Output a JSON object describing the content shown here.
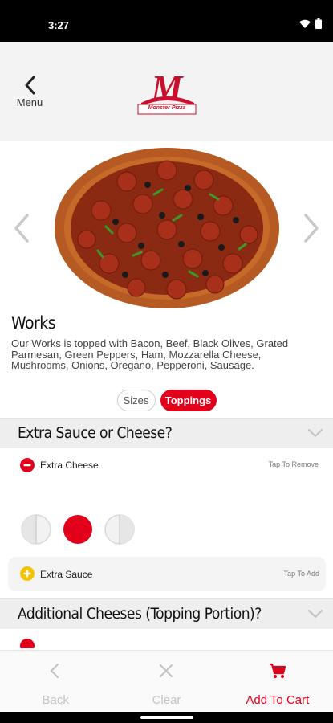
{
  "status_bar": {
    "time": "3:27"
  },
  "header": {
    "back_label": "Menu",
    "logo_letter": "M",
    "logo_text": "Monster Pizza"
  },
  "item": {
    "title": "Works",
    "description": "Our Works is topped with Bacon, Beef, Black Olives, Grated Parmesan, Green Peppers, Ham, Mozzarella Cheese, Mushrooms, Onions, Oregano, Pepperoni, Sausage."
  },
  "tabs": [
    {
      "label": "Sizes",
      "selected": false
    },
    {
      "label": "Toppings",
      "selected": true
    }
  ],
  "sections": [
    {
      "title": "Extra Sauce or Cheese?",
      "options": [
        {
          "label": "Extra Cheese",
          "hint": "Tap To Remove",
          "state": "selected",
          "icon": "minus-circle-icon"
        },
        {
          "label": "Extra Sauce",
          "hint": "Tap To Add",
          "state": "unselected",
          "icon": "plus-circle-icon"
        }
      ],
      "portion_selected": "whole"
    },
    {
      "title": "Additional Cheeses (Topping Portion)?"
    }
  ],
  "bottom_bar": {
    "back_label": "Back",
    "clear_label": "Clear",
    "add_label": "Add To Cart"
  },
  "colors": {
    "accent": "#e3001b",
    "add_icon": "#f6c200",
    "header_bg": "#f3f3f3"
  }
}
